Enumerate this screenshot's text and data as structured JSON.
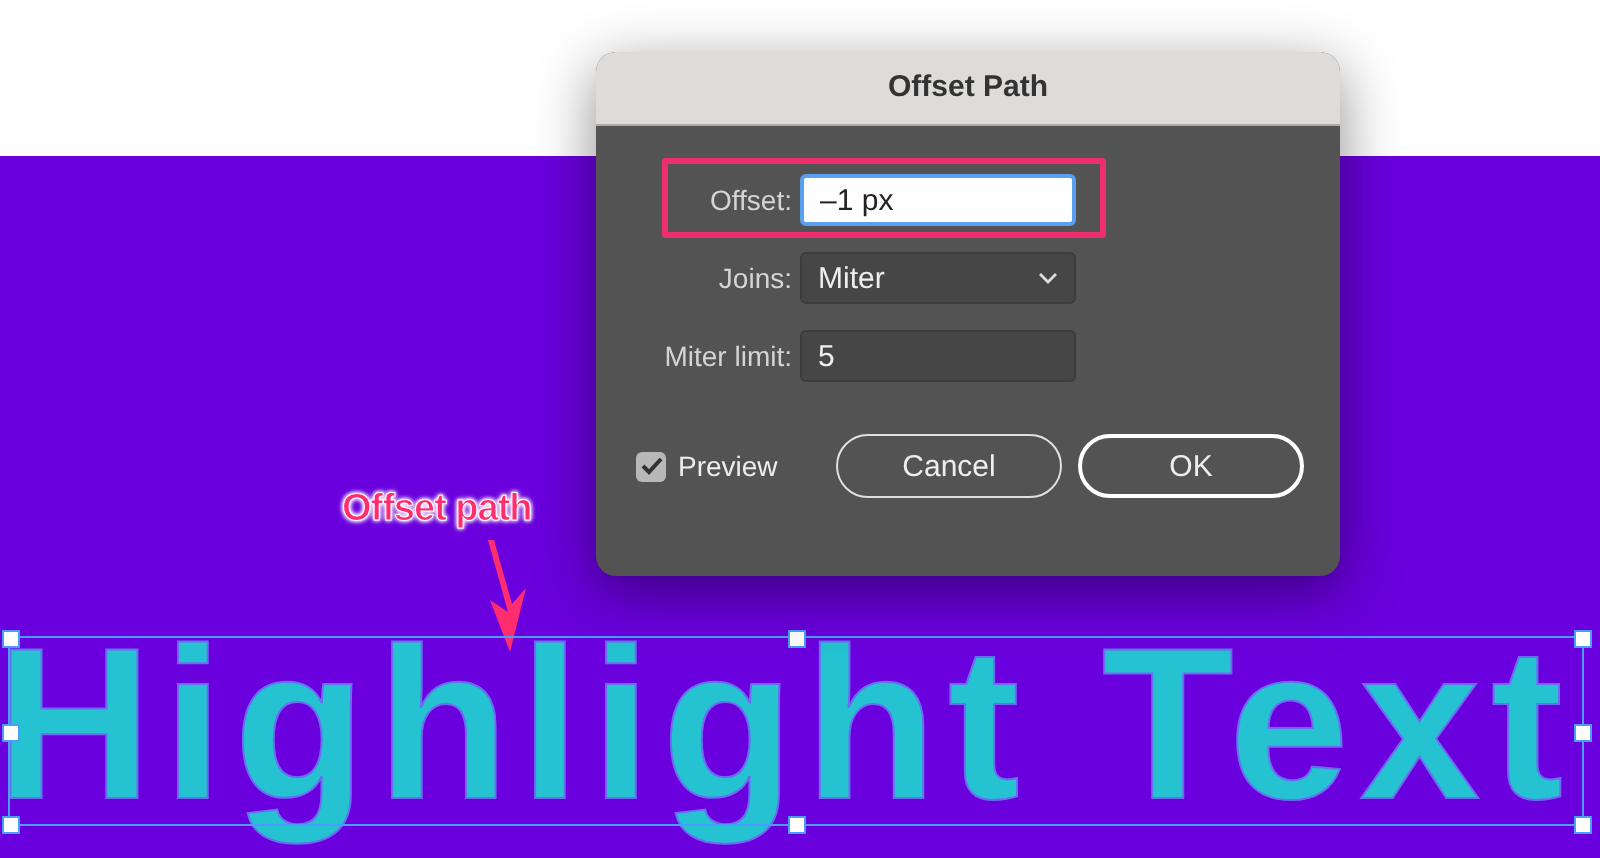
{
  "dialog": {
    "title": "Offset Path",
    "fields": [
      {
        "kind": "text",
        "label": "Offset:",
        "value": "–1 px",
        "highlighted": true
      },
      {
        "kind": "dropdown",
        "label": "Joins:",
        "value": "Miter",
        "highlighted": false
      },
      {
        "kind": "text",
        "label": "Miter limit:",
        "value": "5",
        "highlighted": false
      }
    ],
    "preview": {
      "label": "Preview",
      "checked": true
    },
    "buttons": [
      "Cancel",
      "OK"
    ]
  },
  "annotation": {
    "label": "Offset path"
  },
  "artboard": {
    "text": "Highlight Text",
    "selected": true
  }
}
